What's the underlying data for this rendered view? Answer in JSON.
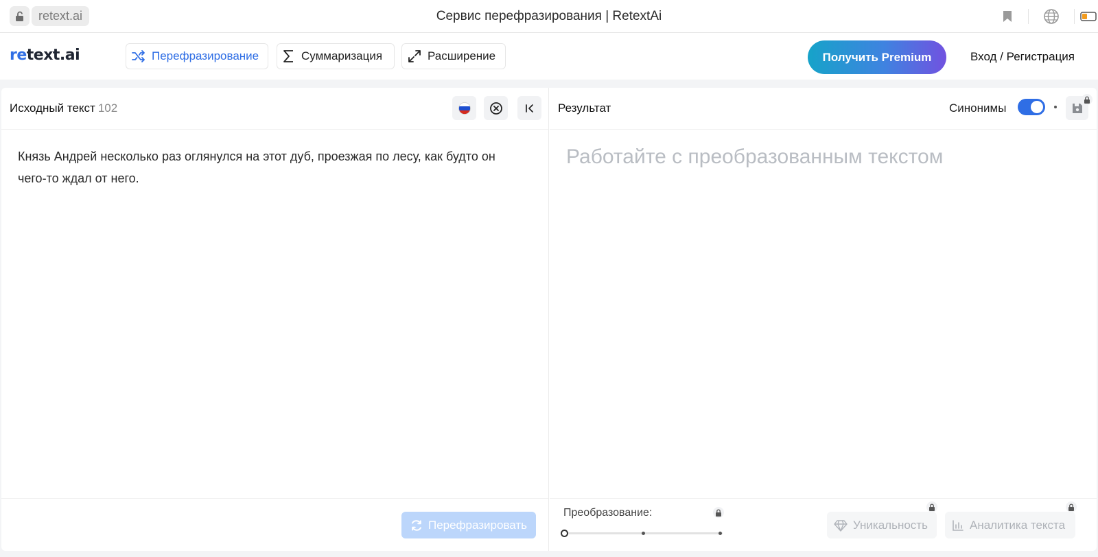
{
  "browser": {
    "url": "retext.ai",
    "tab_title": "Сервис перефразирования | RetextAi",
    "icons": [
      "unlock-icon",
      "bookmark-icon",
      "globe-icon",
      "battery-icon"
    ]
  },
  "header": {
    "logo_re": "re",
    "logo_rest": "text.ai",
    "modes": [
      {
        "label": "Перефразирование",
        "icon": "shuffle-icon",
        "active": true
      },
      {
        "label": "Суммаризация",
        "icon": "sigma-icon",
        "active": false
      },
      {
        "label": "Расширение",
        "icon": "expand-icon",
        "active": false
      }
    ],
    "premium_label": "Получить Premium",
    "login_label": "Вход / Регистрация"
  },
  "source": {
    "title": "Исходный текст",
    "count": "102",
    "text": "Князь Андрей несколько раз оглянулся на этот дуб, проезжая по лесу, как будто он чего-то ждал от него.",
    "paraphrase_label": "Перефразировать"
  },
  "result": {
    "title": "Результат",
    "synonyms_label": "Синонимы",
    "synonyms_on": true,
    "placeholder": "Работайте с преобразованным текстом",
    "transform_label": "Преобразование:",
    "transform_level": 0,
    "uniqueness_label": "Уникальность",
    "analytics_label": "Аналитика текста"
  },
  "colors": {
    "accent": "#2f6ee5",
    "premium_gradient": [
      "#16a3c9",
      "#7152e0"
    ],
    "disabled_button": "#bcd6fb",
    "placeholder": "#b9bdc3"
  }
}
